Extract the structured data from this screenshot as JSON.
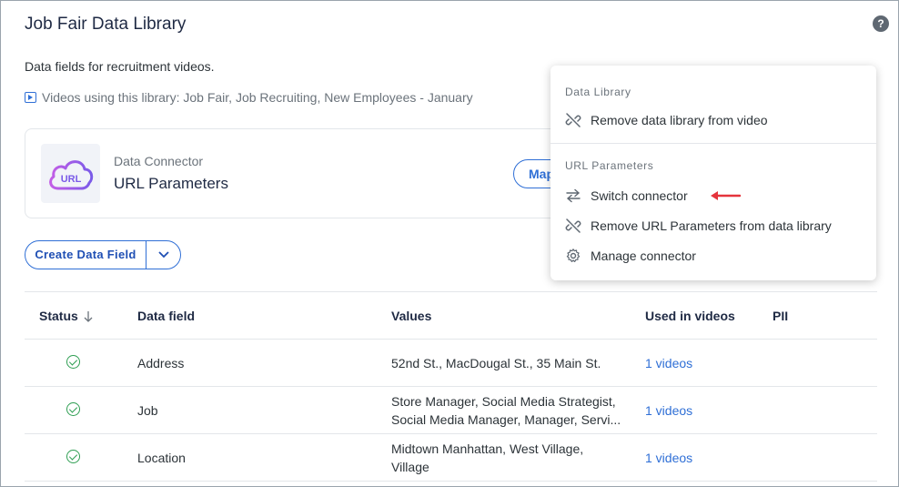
{
  "header": {
    "title": "Job Fair Data Library",
    "help_icon": "help-icon"
  },
  "description": "Data fields for recruitment videos.",
  "videos_using": "Videos using this library: Job Fair, Job Recruiting, New Employees - January",
  "connector": {
    "label": "Data Connector",
    "name": "URL Parameters",
    "logo_text": "URL",
    "map_button": "Map"
  },
  "create_button": {
    "label": "Create Data Field"
  },
  "table": {
    "headers": {
      "status": "Status",
      "field": "Data field",
      "values": "Values",
      "used": "Used in videos",
      "pii": "PII"
    },
    "rows": [
      {
        "field": "Address",
        "values_line1": "52nd St., MacDougal St., 35 Main St.",
        "values_line2": "",
        "used": "1 videos"
      },
      {
        "field": "Job",
        "values_line1": "Store Manager, Social Media Strategist,",
        "values_line2": "Social Media Manager, Manager, Servi...",
        "used": "1 videos"
      },
      {
        "field": "Location",
        "values_line1": "Midtown Manhattan, West Village,",
        "values_line2": "Village",
        "used": "1 videos"
      }
    ]
  },
  "menu": {
    "section1": "Data Library",
    "remove_library": "Remove data library from video",
    "section2": "URL Parameters",
    "switch_connector": "Switch connector",
    "remove_params": "Remove URL Parameters from data library",
    "manage_connector": "Manage connector"
  },
  "colors": {
    "accent": "#2f6fd6",
    "success": "#2e9e52",
    "annotation_arrow": "#e5343c"
  }
}
